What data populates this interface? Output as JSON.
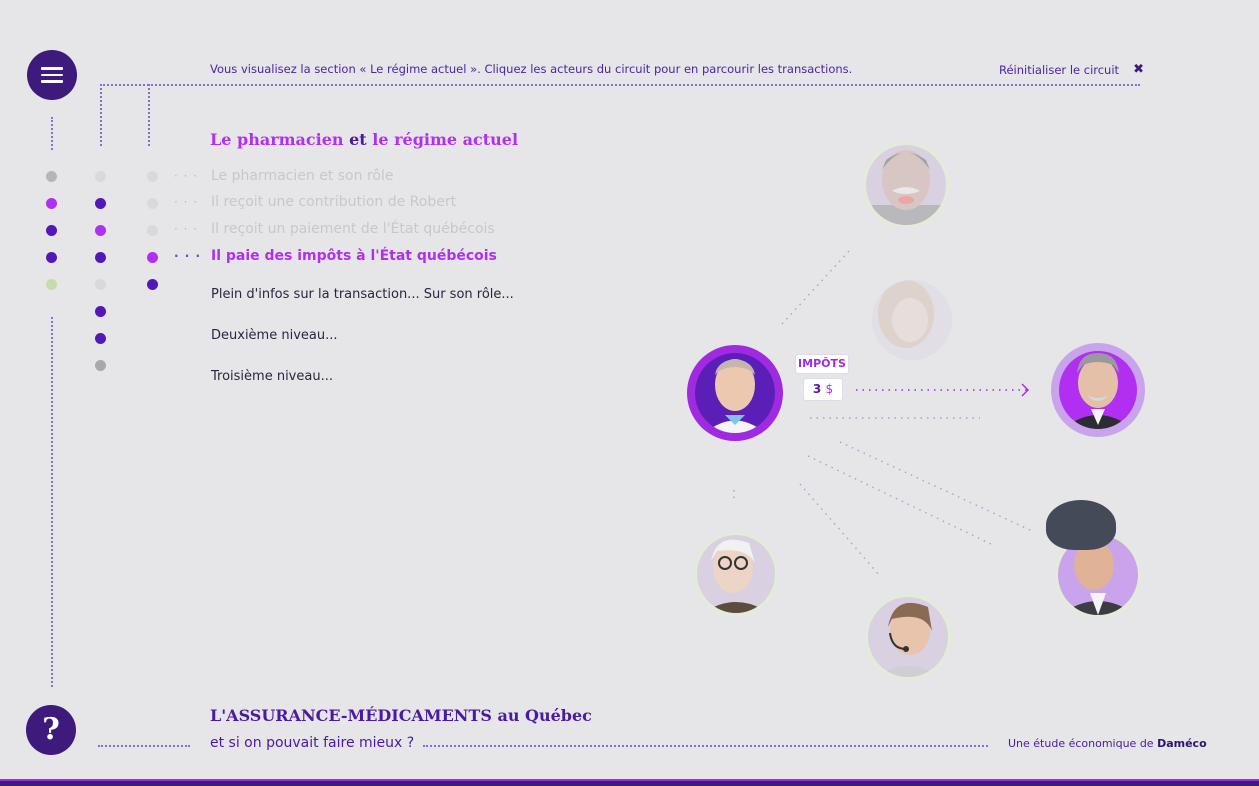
{
  "top": {
    "status_text": "Vous visualisez la section  « Le régime actuel ». Cliquez les acteurs du circuit pour en parcourir les transactions.",
    "reset_label": "Réinitialiser le circuit",
    "reset_icon": "close-icon"
  },
  "section": {
    "title_part1": "Le pharmacien",
    "title_part2": "et",
    "title_part3": "le régime actuel"
  },
  "steps": [
    {
      "label": "Le pharmacien et son rôle",
      "leader": "· · ·"
    },
    {
      "label": "Il reçoit une contribution de Robert",
      "leader": "· · ·"
    },
    {
      "label": "Il reçoit un paiement de l'État québécois",
      "leader": "· · ·"
    },
    {
      "label": "Il paie des impôts à l'État québécois",
      "leader": "· · ·",
      "active": true
    }
  ],
  "details": [
    "Plein d'infos sur la transaction... Sur son rôle...",
    "Deuxième niveau...",
    "Troisième niveau..."
  ],
  "transaction": {
    "label": "IMPÔTS",
    "amount": "3",
    "currency": "$"
  },
  "footer": {
    "title_main": "L'ASSURANCE-MÉDICAMENTS",
    "title_suffix": "au Québec",
    "subtitle": "et si on pouvait faire mieux ?",
    "credit_prefix": "Une étude économique de",
    "credit_brand": "Daméco"
  },
  "colors": {
    "primary": "#3d1a7c",
    "accent": "#b12ff0",
    "background": "#e6e5e7"
  }
}
